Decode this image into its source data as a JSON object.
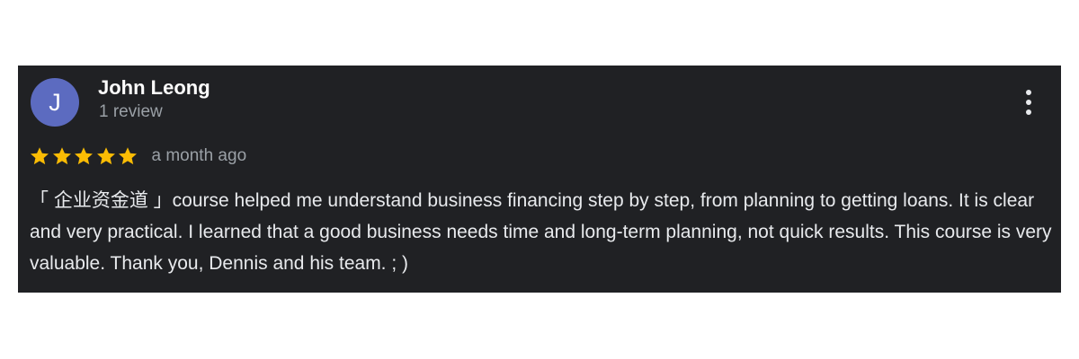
{
  "review": {
    "avatar_letter": "J",
    "avatar_color": "#5c6bc0",
    "reviewer_name": "John Leong",
    "review_count": "1 review",
    "rating": 5,
    "rating_max": 5,
    "star_color": "#fbbc04",
    "date": "a month ago",
    "text": "「 企业资金道 」course helped me understand business financing step by step, from planning to getting loans. It is clear and very practical. I learned that a good business needs time and long-term planning, not quick results. This course is very valuable. Thank you, Dennis and his team. ; )",
    "more_icon": "more-vertical-icon"
  },
  "colors": {
    "card_background": "#202124",
    "name_text": "#ffffff",
    "secondary_text": "#9aa0a6",
    "body_text": "#e8eaed"
  }
}
